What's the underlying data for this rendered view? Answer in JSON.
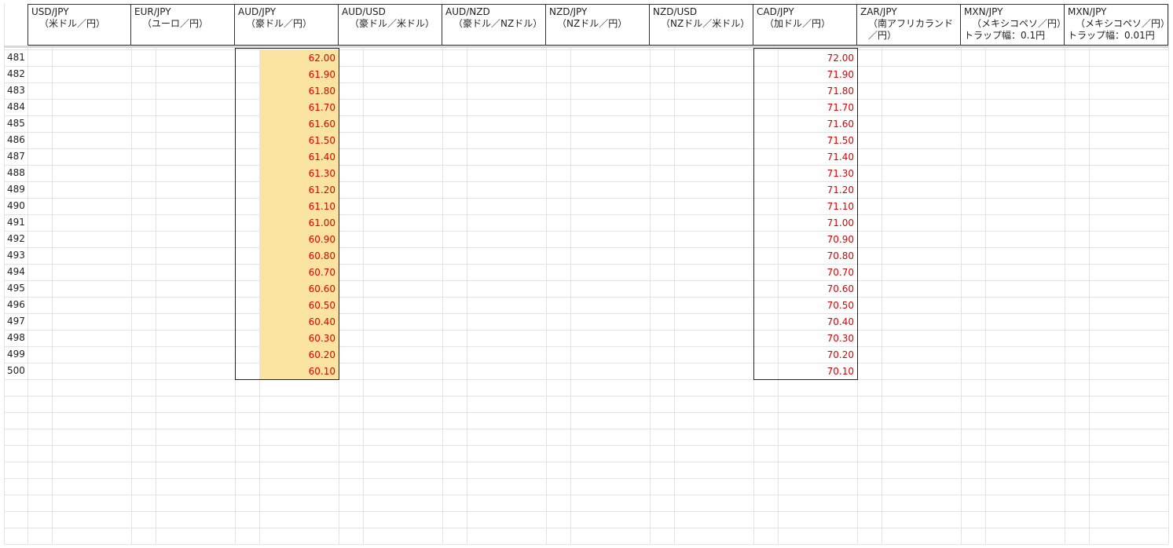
{
  "columns": [
    {
      "line1": "USD/JPY",
      "line2": "（米ドル／円）",
      "line3": ""
    },
    {
      "line1": "EUR/JPY",
      "line2": "（ユーロ／円）",
      "line3": ""
    },
    {
      "line1": "AUD/JPY",
      "line2": "（豪ドル／円）",
      "line3": ""
    },
    {
      "line1": "AUD/USD",
      "line2": "（豪ドル／米ドル）",
      "line3": ""
    },
    {
      "line1": "AUD/NZD",
      "line2": "（豪ドル／NZドル）",
      "line3": ""
    },
    {
      "line1": "NZD/JPY",
      "line2": "（NZドル／円）",
      "line3": ""
    },
    {
      "line1": "NZD/USD",
      "line2": "（NZドル／米ドル）",
      "line3": ""
    },
    {
      "line1": "CAD/JPY",
      "line2": "（加ドル／円）",
      "line3": ""
    },
    {
      "line1": "ZAR/JPY",
      "line2": "（南アフリカランド",
      "line3": "／円）"
    },
    {
      "line1": "MXN/JPY",
      "line2": "（メキシコペソ／円）",
      "line3": "トラップ幅：0.1円"
    },
    {
      "line1": "MXN/JPY",
      "line2": "（メキシコペソ／円）",
      "line3": "トラップ幅：0.01円"
    }
  ],
  "row_numbers": [
    "481",
    "482",
    "483",
    "484",
    "485",
    "486",
    "487",
    "488",
    "489",
    "490",
    "491",
    "492",
    "493",
    "494",
    "495",
    "496",
    "497",
    "498",
    "499",
    "500"
  ],
  "aud_jpy_values": [
    "62.00",
    "61.90",
    "61.80",
    "61.70",
    "61.60",
    "61.50",
    "61.40",
    "61.30",
    "61.20",
    "61.10",
    "61.00",
    "60.90",
    "60.80",
    "60.70",
    "60.60",
    "60.50",
    "60.40",
    "60.30",
    "60.20",
    "60.10"
  ],
  "cad_jpy_values": [
    "72.00",
    "71.90",
    "71.80",
    "71.70",
    "71.60",
    "71.50",
    "71.40",
    "71.30",
    "71.20",
    "71.10",
    "71.00",
    "70.90",
    "70.80",
    "70.70",
    "70.60",
    "70.50",
    "70.40",
    "70.30",
    "70.20",
    "70.10"
  ],
  "colors": {
    "value_text": "#e00000",
    "highlight_fill": "#fbe3a2",
    "gridline": "#e2e3e3",
    "border": "#222222"
  }
}
